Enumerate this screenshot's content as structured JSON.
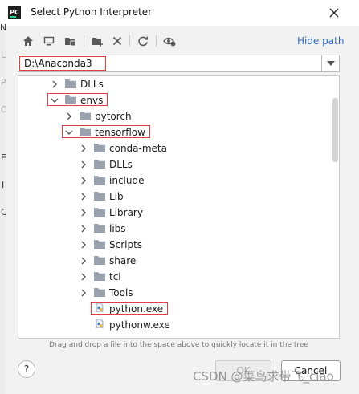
{
  "window": {
    "title": "Select Python Interpreter",
    "app_icon_text": "PC"
  },
  "background_fragments": [
    "N",
    "L",
    "P",
    "C",
    "E",
    "I",
    "C"
  ],
  "toolbar": {
    "icons": [
      "home-icon",
      "desktop-icon",
      "project-icon",
      "new-folder-icon",
      "delete-icon",
      "refresh-icon",
      "show-hidden-icon"
    ],
    "hide_path_label": "Hide path"
  },
  "path": {
    "value": "D:\\Anaconda3"
  },
  "tree": {
    "rows": [
      {
        "label": "DLLs",
        "depth": 1,
        "expanded": false,
        "type": "folder"
      },
      {
        "label": "envs",
        "depth": 1,
        "expanded": true,
        "type": "folder",
        "highlighted": true
      },
      {
        "label": "pytorch",
        "depth": 2,
        "expanded": false,
        "type": "folder"
      },
      {
        "label": "tensorflow",
        "depth": 2,
        "expanded": true,
        "type": "folder",
        "highlighted": true
      },
      {
        "label": "conda-meta",
        "depth": 3,
        "expanded": false,
        "type": "folder"
      },
      {
        "label": "DLLs",
        "depth": 3,
        "expanded": false,
        "type": "folder"
      },
      {
        "label": "include",
        "depth": 3,
        "expanded": false,
        "type": "folder"
      },
      {
        "label": "Lib",
        "depth": 3,
        "expanded": false,
        "type": "folder"
      },
      {
        "label": "Library",
        "depth": 3,
        "expanded": false,
        "type": "folder"
      },
      {
        "label": "libs",
        "depth": 3,
        "expanded": false,
        "type": "folder"
      },
      {
        "label": "Scripts",
        "depth": 3,
        "expanded": false,
        "type": "folder"
      },
      {
        "label": "share",
        "depth": 3,
        "expanded": false,
        "type": "folder"
      },
      {
        "label": "tcl",
        "depth": 3,
        "expanded": false,
        "type": "folder"
      },
      {
        "label": "Tools",
        "depth": 3,
        "expanded": false,
        "type": "folder"
      },
      {
        "label": "python.exe",
        "depth": 3,
        "type": "file",
        "highlighted": true
      },
      {
        "label": "pythonw.exe",
        "depth": 3,
        "type": "file"
      }
    ],
    "hint": "Drag and drop a file into the space above to quickly locate it in the tree"
  },
  "buttons": {
    "help": "?",
    "ok": "OK",
    "cancel": "Cancel"
  },
  "watermark": "CSDN @菜鸟求带飞_ciao",
  "colors": {
    "highlight_border": "#e04040",
    "link": "#2d6bc5",
    "folder": "#9aa3ad"
  }
}
